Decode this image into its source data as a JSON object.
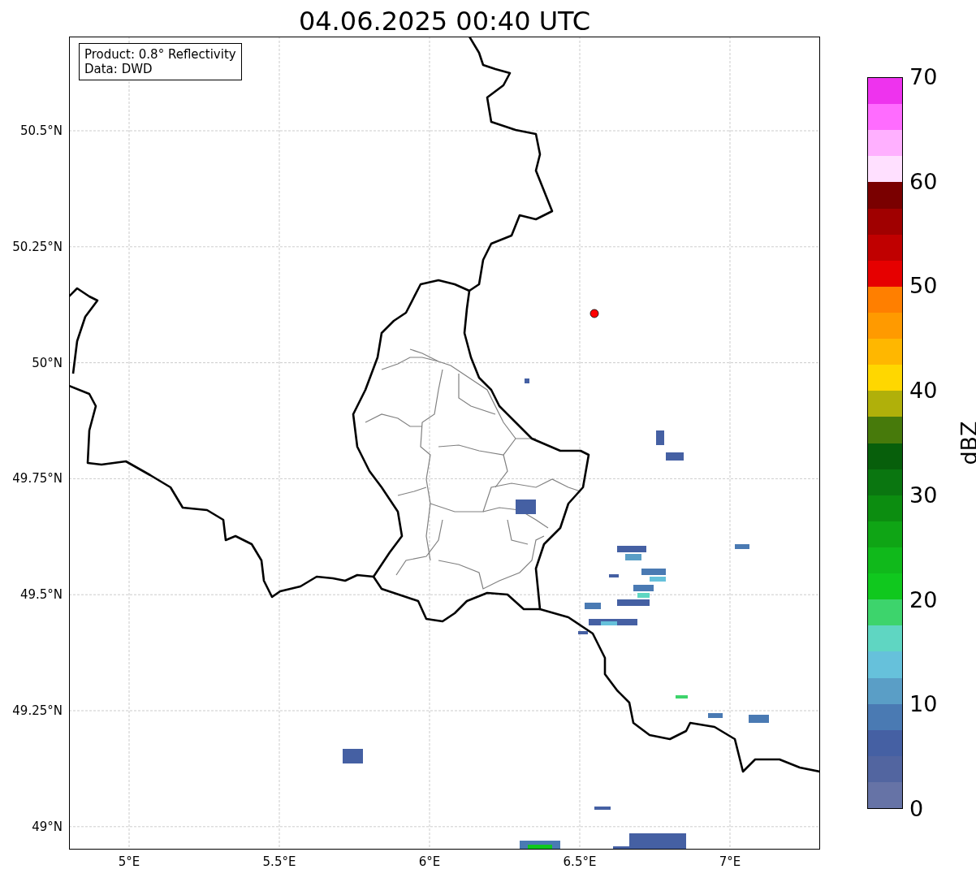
{
  "title": "04.06.2025 00:40 UTC",
  "legend": [
    "Product: 0.8° Reflectivity",
    "Data: DWD"
  ],
  "y_ticks": [
    "50.5°N",
    "50.25°N",
    "50°N",
    "49.75°N",
    "49.5°N",
    "49.25°N",
    "49°N"
  ],
  "x_ticks": [
    "5°E",
    "5.5°E",
    "6°E",
    "6.5°E",
    "7°E"
  ],
  "colorbar": {
    "label": "dBZ",
    "ticks": [
      "70",
      "60",
      "50",
      "40",
      "30",
      "20",
      "10",
      "0"
    ],
    "segments": [
      {
        "color": "#ee33ee"
      },
      {
        "color": "#ff6cff"
      },
      {
        "color": "#ffb0ff"
      },
      {
        "color": "#ffe0ff"
      },
      {
        "color": "#7a0000"
      },
      {
        "color": "#a00000"
      },
      {
        "color": "#c00000"
      },
      {
        "color": "#e60000"
      },
      {
        "color": "#ff7f00"
      },
      {
        "color": "#ff9a00"
      },
      {
        "color": "#ffb700"
      },
      {
        "color": "#ffd700"
      },
      {
        "color": "#b0b00a"
      },
      {
        "color": "#477a0b"
      },
      {
        "color": "#075f0b"
      },
      {
        "color": "#0a7610"
      },
      {
        "color": "#0c8d10"
      },
      {
        "color": "#0fa515"
      },
      {
        "color": "#10b91b"
      },
      {
        "color": "#10c81e"
      },
      {
        "color": "#3dd46c"
      },
      {
        "color": "#5fd6c2"
      },
      {
        "color": "#66c1db"
      },
      {
        "color": "#5a9ec6"
      },
      {
        "color": "#4a7ab3"
      },
      {
        "color": "#4560a3"
      },
      {
        "color": "#5265a0"
      },
      {
        "color": "#6673a6"
      }
    ]
  }
}
